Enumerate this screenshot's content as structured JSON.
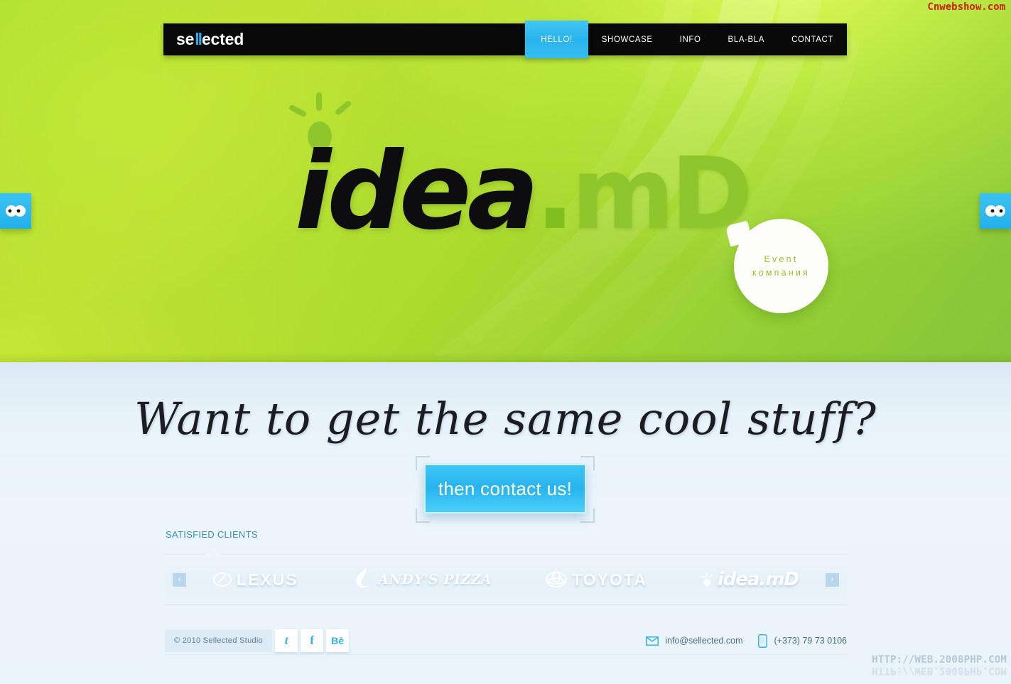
{
  "watermarks": {
    "top_right": "Cnwebshow.com",
    "bottom_right": "HTTP://WEB.2008PHP.COM"
  },
  "header": {
    "brand_pre": "se",
    "brand_mid": "ll",
    "brand_post": "ected",
    "nav": [
      {
        "label": "HELLO!",
        "active": true
      },
      {
        "label": "SHOWCASE",
        "active": false
      },
      {
        "label": "INFO",
        "active": false
      },
      {
        "label": "BLA-BLA",
        "active": false
      },
      {
        "label": "CONTACT",
        "active": false
      }
    ]
  },
  "hero": {
    "logo_word": "idea",
    "logo_dot": ".",
    "logo_tld": "mD",
    "bubble_line1": "Event",
    "bubble_line2": "компания",
    "side_tab_icon": "eyes-icon"
  },
  "cta_section": {
    "headline": "Want to get the same cool stuff?",
    "button_label": "then contact us!"
  },
  "clients": {
    "title": "SATISFIED CLIENTS",
    "prev_arrow": "‹",
    "next_arrow": "›",
    "logos": [
      {
        "name": "lexus",
        "text": "LEXUS"
      },
      {
        "name": "andys-pizza",
        "text": "ANDY'S PIZZA"
      },
      {
        "name": "toyota",
        "text": "TOYOTA"
      },
      {
        "name": "idea-md",
        "text": "idea.mD"
      }
    ]
  },
  "footer": {
    "copyright": "© 2010 Sellected Studio",
    "social": [
      {
        "name": "twitter",
        "glyph": "t"
      },
      {
        "name": "facebook",
        "glyph": "f"
      },
      {
        "name": "behance",
        "glyph": "Bē"
      }
    ],
    "email": "info@sellected.com",
    "phone": "(+373) 79 73 0106"
  },
  "colors": {
    "accent_blue": "#29b3ec",
    "hero_green": "#a8d82e",
    "nav_black": "#090909",
    "logo_green": "#8ec62b",
    "bubble_text": "#a3bb2d",
    "clients_title": "#3b8fb8",
    "watermark_red": "#d01e16"
  }
}
